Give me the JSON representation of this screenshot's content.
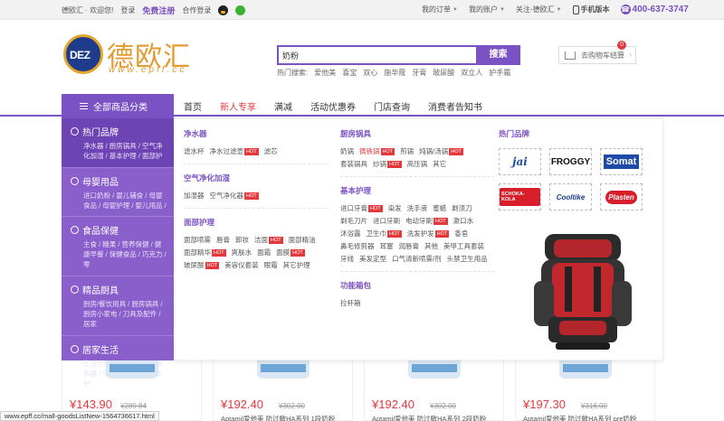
{
  "topbar": {
    "welcome": "德欧汇 · 欢迎您!",
    "login": "登录",
    "register": "免费注册",
    "partner_login": "合作登录",
    "my_orders": "我的订单",
    "my_account": "我的账户",
    "follow": "关注-德欧汇",
    "mobile": "手机版本",
    "phone": "400-637-3747"
  },
  "logo": {
    "badge": "DEZ",
    "name": "德欧汇",
    "url": "www.epff.cc"
  },
  "search": {
    "value": "奶粉",
    "button": "搜索",
    "hot_label": "热门搜索:",
    "hot_terms": [
      "爱他美",
      "喜宝",
      "双心",
      "施华蔻",
      "牙膏",
      "玻尿酸",
      "双立人",
      "护手霜"
    ]
  },
  "cart": {
    "label": "去购物车结算",
    "count": "0"
  },
  "nav": {
    "all_categories": "全部商品分类",
    "items": [
      "首页",
      "新人专享",
      "满减",
      "活动优惠券",
      "门店查询",
      "消费者告知书"
    ]
  },
  "sidebar": [
    {
      "title": "热门品牌",
      "desc": "净水器 / 厨房锅具 / 空气净化加湿 / 基本护理 / 面部护"
    },
    {
      "title": "母婴用品",
      "desc": "进口奶粉 / 婴儿辅食 / 母婴食品 / 母婴护理 / 婴儿用品 /"
    },
    {
      "title": "食品保健",
      "desc": "主食 / 糖果 / 营养保健 / 健康早餐 / 保健食品 / 巧克力 / 零"
    },
    {
      "title": "精品厨具",
      "desc": "厨房/餐饮用具 / 厨房锅具 / 厨房小家电 / 刀具及配件 / 居家"
    },
    {
      "title": "居家生活",
      "desc": "生活小家电 / 生活用品 / 净水器 / 空气净化加湿 / 基本护"
    }
  ],
  "panel": {
    "col1": [
      {
        "heading": "净水器",
        "items": [
          "滤水杯",
          "净水过滤壶|HOT",
          "滤芯"
        ]
      },
      {
        "heading": "空气净化加湿",
        "items": [
          "加湿器",
          "空气净化器|HOT"
        ]
      },
      {
        "heading": "面部护理",
        "items": [
          "面部喷雾",
          "唇膏",
          "卸妆",
          "洁面|HOT",
          "面部精油",
          "面部精华|HOT",
          "爽肤水",
          "面霜",
          "面膜|HOT",
          "玻尿酸|HOT",
          "美容仪套装",
          "眼霜",
          "其它护理"
        ]
      }
    ],
    "col2": [
      {
        "heading": "厨房锅具",
        "items": [
          "奶锅",
          "铸铁锅|HOT",
          "煎锅",
          "炖锅/汤锅|HOT",
          "套装锅具",
          "炒锅|HOT",
          "高压锅",
          "其它"
        ]
      },
      {
        "heading": "基本护理",
        "items": [
          "进口牙膏|HOT",
          "染发",
          "洗手液",
          "蜜蜡",
          "剃须刀",
          "剃毛刀片",
          "进口牙刷",
          "电动牙刷|HOT",
          "漱口水",
          "沐浴露",
          "卫生巾|HOT",
          "洗发护发|HOT",
          "香皂",
          "鼻毛修剪器",
          "耳塞",
          "润唇膏",
          "其他",
          "美甲工具套装",
          "牙线",
          "美发定型",
          "口气清新喷雾/剂",
          "头禁卫生用品"
        ]
      },
      {
        "heading": "功能箱包",
        "items": [
          "拉杆箱"
        ]
      }
    ],
    "col3": {
      "heading": "热门品牌",
      "brands": [
        "jai",
        "FROGGY",
        "Somat",
        "SCHOKA-KOLA",
        "Cooltike",
        "Plasten"
      ]
    }
  },
  "products": [
    {
      "price": "¥143.90",
      "old": "¥289.84",
      "title": ""
    },
    {
      "price": "¥192.40",
      "old": "¥302.00",
      "title": "Aptamil爱他美 防过敏HA系列 1段奶粉"
    },
    {
      "price": "¥192.40",
      "old": "¥302.00",
      "title": "Aptamil爱他美 防过敏HA系列 2段奶粉"
    },
    {
      "price": "¥197.30",
      "old": "¥316.00",
      "title": "Aptamil爱他美 防过敏HA系列 pre奶粉"
    }
  ],
  "status_url": "www.epff.cc/mall-goodsListNew-1564736617.html",
  "colors": {
    "accent": "#7b52c3",
    "hot": "#e4393c",
    "logo_gold": "#e39a2e"
  }
}
